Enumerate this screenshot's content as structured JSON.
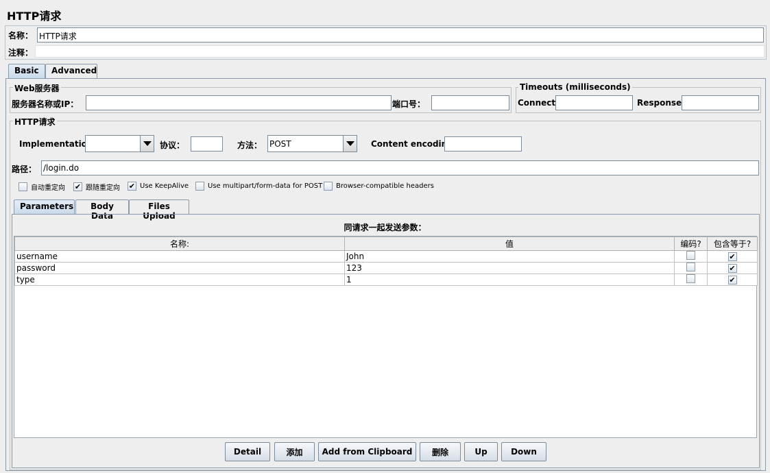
{
  "page_title": "HTTP请求",
  "name": {
    "label": "名称：",
    "value": "HTTP请求"
  },
  "comment": {
    "label": "注释：",
    "value": ""
  },
  "tabs": [
    {
      "label": "Basic",
      "selected": true
    },
    {
      "label": "Advanced",
      "selected": false
    }
  ],
  "web_server": {
    "group_label": "Web服务器",
    "server_label": "服务器名称或IP：",
    "server_value": "",
    "port_label": "端口号：",
    "port_value": ""
  },
  "timeouts": {
    "group_label": "Timeouts (milliseconds)",
    "connect_label": "Connect:",
    "connect_value": "",
    "response_label": "Response:",
    "response_value": ""
  },
  "http_request": {
    "group_label": "HTTP请求",
    "implementation_label": "Implementation:",
    "implementation_value": "",
    "protocol_label": "协议：",
    "protocol_value": "",
    "method_label": "方法：",
    "method_value": "POST",
    "encoding_label": "Content encoding:",
    "encoding_value": "",
    "path_label": "路径：",
    "path_value": "/login.do"
  },
  "options": [
    {
      "label": "自动重定向",
      "checked": false
    },
    {
      "label": "跟随重定向",
      "checked": true
    },
    {
      "label": "Use KeepAlive",
      "checked": true
    },
    {
      "label": "Use multipart/form-data for POST",
      "checked": false
    },
    {
      "label": "Browser-compatible headers",
      "checked": false
    }
  ],
  "sub_tabs": [
    {
      "label": "Parameters",
      "selected": true
    },
    {
      "label": "Body Data",
      "selected": false
    },
    {
      "label": "Files Upload",
      "selected": false
    }
  ],
  "params": {
    "caption": "同请求一起发送参数：",
    "headers": {
      "name": "名称:",
      "value": "值",
      "encode": "编码?",
      "include_equals": "包含等于?"
    },
    "rows": [
      {
        "name": "username",
        "value": "John",
        "encode": false,
        "include_equals": true
      },
      {
        "name": "password",
        "value": "123",
        "encode": false,
        "include_equals": true
      },
      {
        "name": "type",
        "value": "1",
        "encode": false,
        "include_equals": true
      }
    ]
  },
  "buttons": {
    "detail": "Detail",
    "add": "添加",
    "add_clipboard": "Add from Clipboard",
    "delete": "删除",
    "up": "Up",
    "down": "Down"
  },
  "icons": {
    "check": "✔"
  }
}
